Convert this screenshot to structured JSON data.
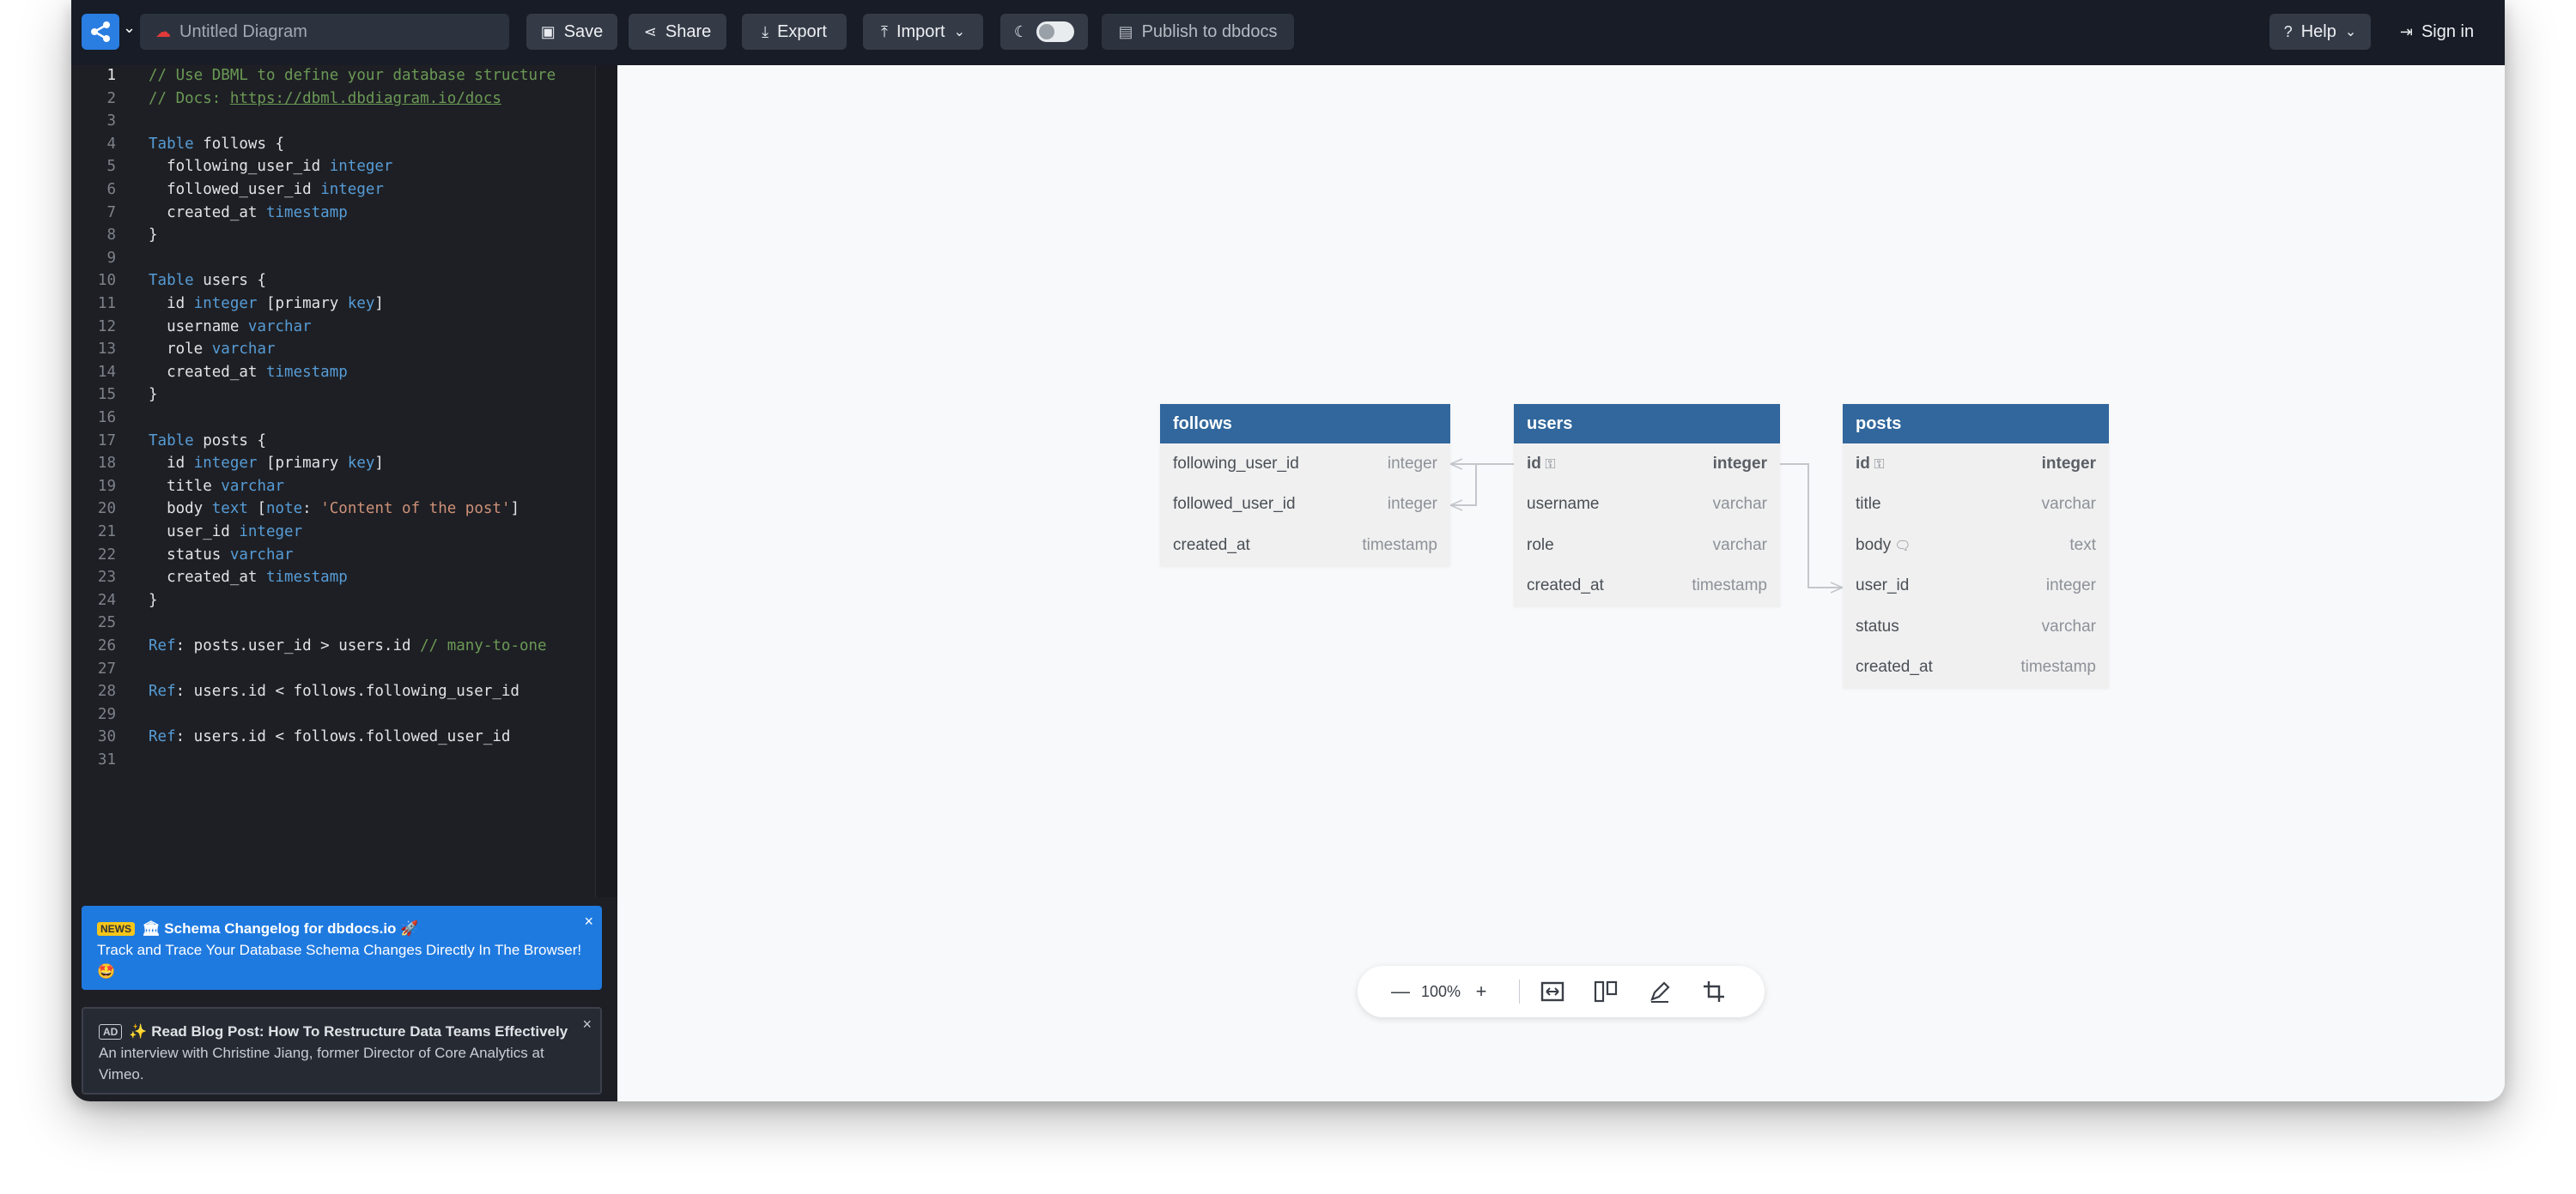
{
  "topbar": {
    "title_placeholder": "Untitled Diagram",
    "save": "Save",
    "share": "Share",
    "export": "Export",
    "import": "Import",
    "publish": "Publish to dbdocs",
    "help": "Help",
    "signin": "Sign in"
  },
  "editor": {
    "lines": [
      [
        {
          "t": "// Use DBML to define your database structure",
          "c": "c-com"
        }
      ],
      [
        {
          "t": "// Docs: ",
          "c": "c-com"
        },
        {
          "t": "https://dbml.dbdiagram.io/docs",
          "c": "c-link"
        }
      ],
      [],
      [
        {
          "t": "Table",
          "c": "c-kw"
        },
        {
          "t": " follows {",
          "c": "c-pl"
        }
      ],
      [
        {
          "t": "  following_user_id ",
          "c": "c-pl"
        },
        {
          "t": "integer",
          "c": "c-kw"
        }
      ],
      [
        {
          "t": "  followed_user_id ",
          "c": "c-pl"
        },
        {
          "t": "integer",
          "c": "c-kw"
        }
      ],
      [
        {
          "t": "  created_at ",
          "c": "c-pl"
        },
        {
          "t": "timestamp",
          "c": "c-kw"
        }
      ],
      [
        {
          "t": "}",
          "c": "c-pl"
        }
      ],
      [],
      [
        {
          "t": "Table",
          "c": "c-kw"
        },
        {
          "t": " users {",
          "c": "c-pl"
        }
      ],
      [
        {
          "t": "  id ",
          "c": "c-pl"
        },
        {
          "t": "integer",
          "c": "c-kw"
        },
        {
          "t": " [primary ",
          "c": "c-pl"
        },
        {
          "t": "key",
          "c": "c-kw"
        },
        {
          "t": "]",
          "c": "c-pl"
        }
      ],
      [
        {
          "t": "  username ",
          "c": "c-pl"
        },
        {
          "t": "varchar",
          "c": "c-kw"
        }
      ],
      [
        {
          "t": "  role ",
          "c": "c-pl"
        },
        {
          "t": "varchar",
          "c": "c-kw"
        }
      ],
      [
        {
          "t": "  created_at ",
          "c": "c-pl"
        },
        {
          "t": "timestamp",
          "c": "c-kw"
        }
      ],
      [
        {
          "t": "}",
          "c": "c-pl"
        }
      ],
      [],
      [
        {
          "t": "Table",
          "c": "c-kw"
        },
        {
          "t": " posts {",
          "c": "c-pl"
        }
      ],
      [
        {
          "t": "  id ",
          "c": "c-pl"
        },
        {
          "t": "integer",
          "c": "c-kw"
        },
        {
          "t": " [primary ",
          "c": "c-pl"
        },
        {
          "t": "key",
          "c": "c-kw"
        },
        {
          "t": "]",
          "c": "c-pl"
        }
      ],
      [
        {
          "t": "  title ",
          "c": "c-pl"
        },
        {
          "t": "varchar",
          "c": "c-kw"
        }
      ],
      [
        {
          "t": "  body ",
          "c": "c-pl"
        },
        {
          "t": "text",
          "c": "c-kw"
        },
        {
          "t": " [",
          "c": "c-pl"
        },
        {
          "t": "note",
          "c": "c-kw"
        },
        {
          "t": ": ",
          "c": "c-pl"
        },
        {
          "t": "'Content of the post'",
          "c": "c-str"
        },
        {
          "t": "]",
          "c": "c-pl"
        }
      ],
      [
        {
          "t": "  user_id ",
          "c": "c-pl"
        },
        {
          "t": "integer",
          "c": "c-kw"
        }
      ],
      [
        {
          "t": "  status ",
          "c": "c-pl"
        },
        {
          "t": "varchar",
          "c": "c-kw"
        }
      ],
      [
        {
          "t": "  created_at ",
          "c": "c-pl"
        },
        {
          "t": "timestamp",
          "c": "c-kw"
        }
      ],
      [
        {
          "t": "}",
          "c": "c-pl"
        }
      ],
      [],
      [
        {
          "t": "Ref",
          "c": "c-kw"
        },
        {
          "t": ": posts.user_id > users.id ",
          "c": "c-pl"
        },
        {
          "t": "// many-to-one",
          "c": "c-com"
        }
      ],
      [],
      [
        {
          "t": "Ref",
          "c": "c-kw"
        },
        {
          "t": ": users.id < follows.following_user_id",
          "c": "c-pl"
        }
      ],
      [],
      [
        {
          "t": "Ref",
          "c": "c-kw"
        },
        {
          "t": ": users.id < follows.followed_user_id",
          "c": "c-pl"
        }
      ],
      []
    ]
  },
  "news": {
    "tag": "NEWS",
    "title": "🏛 Schema Changelog for dbdocs.io 🚀",
    "body": "Track and Trace Your Database Schema Changes Directly In The Browser! 🤩"
  },
  "ad": {
    "tag": "AD",
    "title": "✨ Read Blog Post: How To Restructure Data Teams Effectively",
    "body": "An interview with Christine Jiang, former Director of Core Analytics at Vimeo."
  },
  "diagram": {
    "tables": [
      {
        "name": "follows",
        "columns": [
          {
            "name": "following_user_id",
            "type": "integer",
            "pk": false,
            "note": false
          },
          {
            "name": "followed_user_id",
            "type": "integer",
            "pk": false,
            "note": false
          },
          {
            "name": "created_at",
            "type": "timestamp",
            "pk": false,
            "note": false
          }
        ]
      },
      {
        "name": "users",
        "columns": [
          {
            "name": "id",
            "type": "integer",
            "pk": true,
            "note": false
          },
          {
            "name": "username",
            "type": "varchar",
            "pk": false,
            "note": false
          },
          {
            "name": "role",
            "type": "varchar",
            "pk": false,
            "note": false
          },
          {
            "name": "created_at",
            "type": "timestamp",
            "pk": false,
            "note": false
          }
        ]
      },
      {
        "name": "posts",
        "columns": [
          {
            "name": "id",
            "type": "integer",
            "pk": true,
            "note": false
          },
          {
            "name": "title",
            "type": "varchar",
            "pk": false,
            "note": false
          },
          {
            "name": "body",
            "type": "text",
            "pk": false,
            "note": true
          },
          {
            "name": "user_id",
            "type": "integer",
            "pk": false,
            "note": false
          },
          {
            "name": "status",
            "type": "varchar",
            "pk": false,
            "note": false
          },
          {
            "name": "created_at",
            "type": "timestamp",
            "pk": false,
            "note": false
          }
        ]
      }
    ],
    "refs": [
      {
        "from": "posts.user_id",
        "to": "users.id"
      },
      {
        "from": "users.id",
        "to": "follows.following_user_id"
      },
      {
        "from": "users.id",
        "to": "follows.followed_user_id"
      }
    ]
  },
  "zoom": {
    "level": "100%"
  },
  "colors": {
    "topbar": "#171c26",
    "table_header": "#31679c",
    "accent": "#1f7ae0",
    "editor_bg": "#1e1f24"
  }
}
